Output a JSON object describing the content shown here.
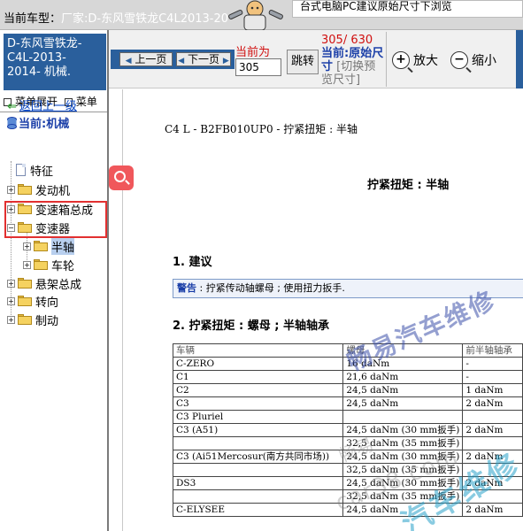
{
  "topbar": {
    "vehicle_label": "当前车型：",
    "vehicle_value": "厂家:D-东风雪铁龙C4L2013-20",
    "notice": "台式电脑PC建议原始尺寸下浏览"
  },
  "sidebar": {
    "vehicle_title_lines": [
      "D-东风雪铁龙-",
      "C4L-2013-",
      "2014- 机械."
    ],
    "menu_expand": "菜单展开",
    "menu_other": "菜单",
    "back_link": "返回上一级",
    "current": "当前:机械",
    "tree": [
      {
        "label": "特征",
        "type": "doc"
      },
      {
        "label": "发动机",
        "type": "folder"
      },
      {
        "label": "变速箱总成",
        "type": "folder"
      },
      {
        "label": "变速器",
        "type": "folder"
      },
      {
        "label": "半轴",
        "type": "folder"
      },
      {
        "label": "车轮",
        "type": "folder"
      },
      {
        "label": "悬架总成",
        "type": "folder"
      },
      {
        "label": "转向",
        "type": "folder"
      },
      {
        "label": "制动",
        "type": "folder"
      }
    ]
  },
  "toolbar": {
    "prev_label": "上一页",
    "next_label": "下一页",
    "current_label": "当前为",
    "page_input_value": "305",
    "jump_label": "跳转",
    "page_count": "305/ 630",
    "page_prefix": "当",
    "page_status": "前:原始尺寸",
    "page_switch": "[切换预览尺寸]",
    "zoom_in": "放大",
    "zoom_out": "缩小"
  },
  "document": {
    "header": "C4 L - B2FB010UP0 - 拧紧扭矩 : 半轴",
    "title": "拧紧扭矩 : 半轴",
    "section1": "1. 建议",
    "warning_label": "警告",
    "warning_text": " : 拧紧传动轴螺母 ; 使用扭力扳手.",
    "section2": "2. 拧紧扭矩 : 螺母 ; 半轴轴承",
    "table": {
      "headers": [
        "车辆",
        "螺母",
        "前半轴轴承"
      ],
      "rows": [
        [
          "C-ZERO",
          "16 daNm",
          "-"
        ],
        [
          "C1",
          "21,6 daNm",
          "-"
        ],
        [
          "C2",
          "24,5 daNm",
          "1 daNm"
        ],
        [
          "C3",
          "24,5 daNm",
          "2 daNm"
        ],
        [
          "C3 Pluriel",
          "",
          ""
        ],
        [
          "C3 (A51)",
          "24,5 daNm (30 mm扳手)",
          "2 daNm"
        ],
        [
          "",
          "32,5 daNm (35 mm扳手)",
          ""
        ],
        [
          "C3 (Ai51Mercosur(南方共同市场))",
          "24,5 daNm (30 mm扳手)",
          "2 daNm"
        ],
        [
          "",
          "32,5 daNm (35 mm扳手)",
          ""
        ],
        [
          "DS3",
          "24,5 daNm (30 mm扳手)",
          "2 daNm"
        ],
        [
          "",
          "32,5 daNm (35 mm扳手)",
          ""
        ],
        [
          "C-ELYSEE",
          "24,5 daNm",
          "2 daNm"
        ]
      ]
    },
    "watermark_1": "畅易汽车维修",
    "watermark_2": "畅易",
    "watermark_3": "car38.com",
    "watermark_4": "汽车维修"
  }
}
